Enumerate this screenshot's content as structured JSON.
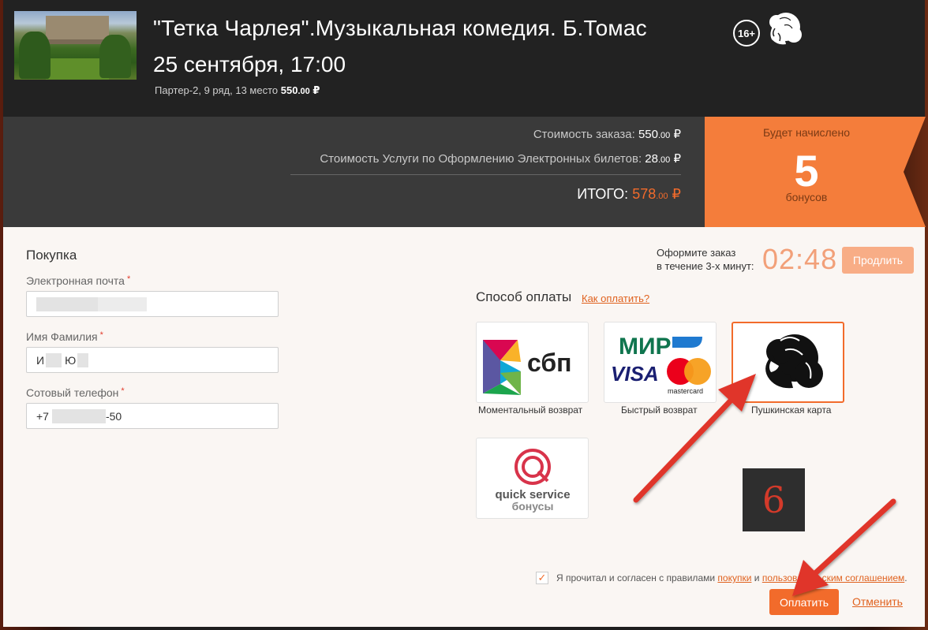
{
  "event": {
    "title": "\"Тетка Чарлея\".Музыкальная комедия. Б.Томас",
    "age_rating": "16+",
    "date": "25 сентября, 17:00",
    "seat": "Партер-2, 9 ряд, 13 место",
    "seat_price": "550",
    "seat_price_kop": ".00",
    "currency": "₽"
  },
  "summary": {
    "order_label": "Стоимость заказа:",
    "order_value": "550",
    "service_label": "Стоимость Услуги по Оформлению Электронных билетов:",
    "service_value": "28",
    "kop": ".00",
    "total_label": "ИТОГО:",
    "total_value": "578",
    "currency": "₽"
  },
  "bonus": {
    "caption": "Будет начислено",
    "value": "5",
    "unit": "бонусов"
  },
  "form": {
    "title": "Покупка",
    "required_mark": "*",
    "email_label": "Электронная почта",
    "name_label": "Имя Фамилия",
    "name_value_start": "И",
    "name_value_mid": "Ю",
    "phone_label": "Сотовый телефон",
    "phone_prefix": "+7",
    "phone_suffix": "-50"
  },
  "timer": {
    "text_line1": "Оформите заказ",
    "text_line2": "в течение 3-х минут:",
    "value": "02:48",
    "extend_label": "Продлить"
  },
  "payment": {
    "title": "Способ оплаты",
    "how_link": "Как оплатить?",
    "methods": [
      {
        "label": "Моментальный возврат",
        "logo_text": "сбп"
      },
      {
        "label": "Быстрый возврат",
        "logo_top": "МИР",
        "logo_visa": "VISA",
        "logo_mc": "mastercard"
      },
      {
        "label": "Пушкинская карта"
      },
      {
        "logo_line1": "quick service",
        "logo_line2": "бонусы"
      }
    ]
  },
  "badge": "6",
  "agreement": {
    "text": "Я прочитал и согласен с правилами",
    "link1": "покупки",
    "and": "и",
    "link2": "пользовательским соглашением",
    "dot": "."
  },
  "actions": {
    "pay_label": "Оплатить",
    "cancel_label": "Отменить"
  },
  "colors": {
    "accent": "#f26b2b",
    "header_bg": "#222222",
    "summary_bg": "#3a3a3a",
    "bonus_bg": "#f47d3b",
    "annotation_arrow": "#e0342a"
  }
}
